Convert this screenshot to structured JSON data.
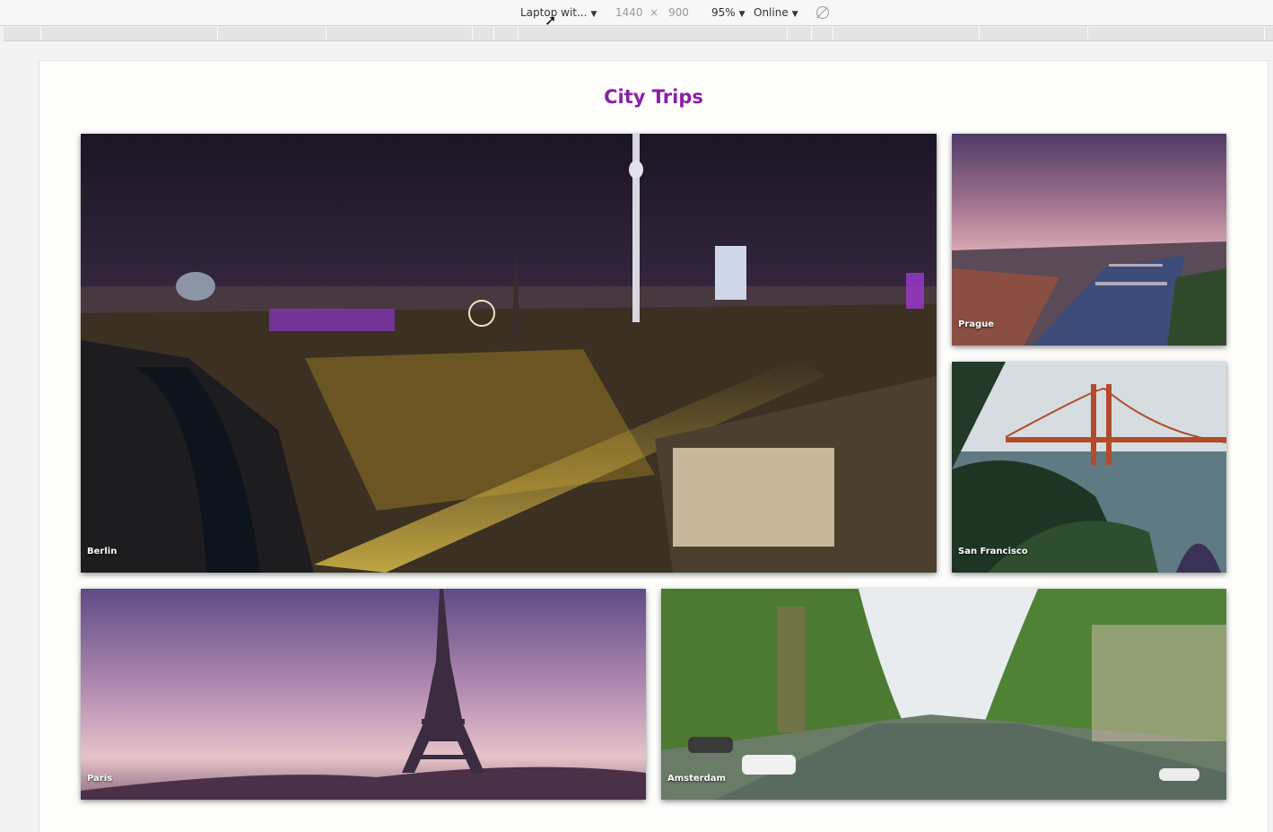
{
  "devtools": {
    "device": "Laptop wit...",
    "width": "1440",
    "times": "×",
    "height": "900",
    "zoom": "95%",
    "network": "Online",
    "rotate_icon": "rotate-icon"
  },
  "page": {
    "title": "City Trips",
    "cities": [
      {
        "name": "Berlin"
      },
      {
        "name": "Prague"
      },
      {
        "name": "San Francisco"
      },
      {
        "name": "Paris"
      },
      {
        "name": "Amsterdam"
      }
    ]
  },
  "colors": {
    "title": "#8a1fa3"
  }
}
